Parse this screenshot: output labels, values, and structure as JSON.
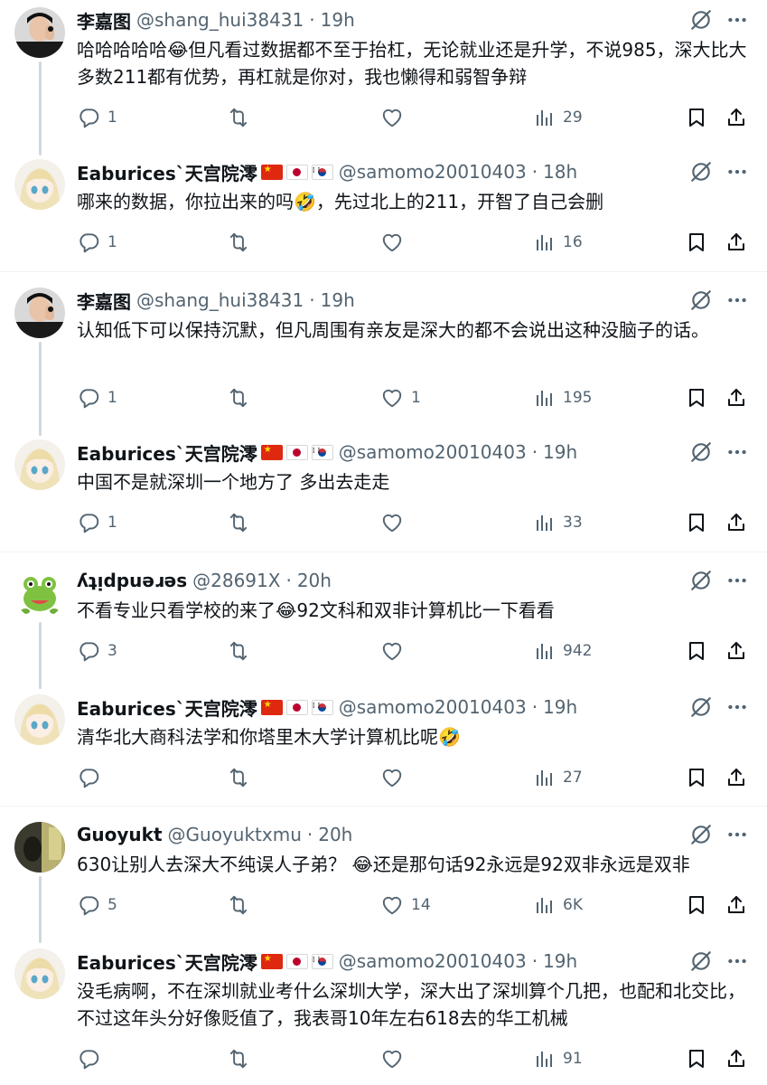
{
  "tweets": [
    {
      "name": "李嘉图",
      "handle": "@shang_hui38431",
      "time": "19h",
      "flags": false,
      "text": "哈哈哈哈哈😂但凡看过数据都不至于抬杠，无论就业还是升学，不说985，深大比大多数211都有优势，再杠就是你对，我也懒得和弱智争辩",
      "replies": "1",
      "retweets": "",
      "likes": "",
      "views": "29"
    },
    {
      "name": "Eaburices`天宫院澪",
      "handle": "@samomo20010403",
      "time": "18h",
      "flags": true,
      "text": "哪来的数据，你拉出来的吗🤣，先过北上的211，开智了自己会删",
      "replies": "1",
      "retweets": "",
      "likes": "",
      "views": "16"
    },
    {
      "name": "李嘉图",
      "handle": "@shang_hui38431",
      "time": "19h",
      "flags": false,
      "text": "认知低下可以保持沉默，但凡周围有亲友是深大的都不会说出这种没脑子的话。",
      "replies": "1",
      "retweets": "",
      "likes": "1",
      "views": "195"
    },
    {
      "name": "Eaburices`天宫院澪",
      "handle": "@samomo20010403",
      "time": "19h",
      "flags": true,
      "text": "中国不是就深圳一个地方了 多出去走走",
      "replies": "1",
      "retweets": "",
      "likes": "",
      "views": "33"
    },
    {
      "name": "ʎʇᴉdpuǝɹǝs",
      "handle": "@28691X",
      "time": "20h",
      "flags": false,
      "text": "不看专业只看学校的来了😂92文科和双非计算机比一下看看",
      "replies": "3",
      "retweets": "",
      "likes": "",
      "views": "942"
    },
    {
      "name": "Eaburices`天宫院澪",
      "handle": "@samomo20010403",
      "time": "19h",
      "flags": true,
      "text": "清华北大商科法学和你塔里木大学计算机比呢🤣",
      "replies": "",
      "retweets": "",
      "likes": "",
      "views": "27"
    },
    {
      "name": "Guoyukt",
      "handle": "@Guoyuktxmu",
      "time": "20h",
      "flags": false,
      "text": "630让别人去深大不纯误人子弟？ 😂还是那句话92永远是92双非永远是双非",
      "replies": "5",
      "retweets": "",
      "likes": "14",
      "views": "6K"
    },
    {
      "name": "Eaburices`天宫院澪",
      "handle": "@samomo20010403",
      "time": "19h",
      "flags": true,
      "text": "没毛病啊，不在深圳就业考什么深圳大学，深大出了深圳算个几把，也配和北交比，不过这年头分好像贬值了，我表哥10年左右618去的华工机械",
      "replies": "",
      "retweets": "",
      "likes": "",
      "views": "91"
    }
  ],
  "colors": {
    "text": "#0f1419",
    "secondary": "#536471",
    "thread_line": "#cfd9de",
    "separator": "#eff3f4"
  },
  "icons": {
    "reply": "reply-icon",
    "retweet": "retweet-icon",
    "like": "heart-icon",
    "views": "views-icon",
    "bookmark": "bookmark-icon",
    "share": "share-icon",
    "grok": "grok-icon",
    "more": "more-icon"
  }
}
